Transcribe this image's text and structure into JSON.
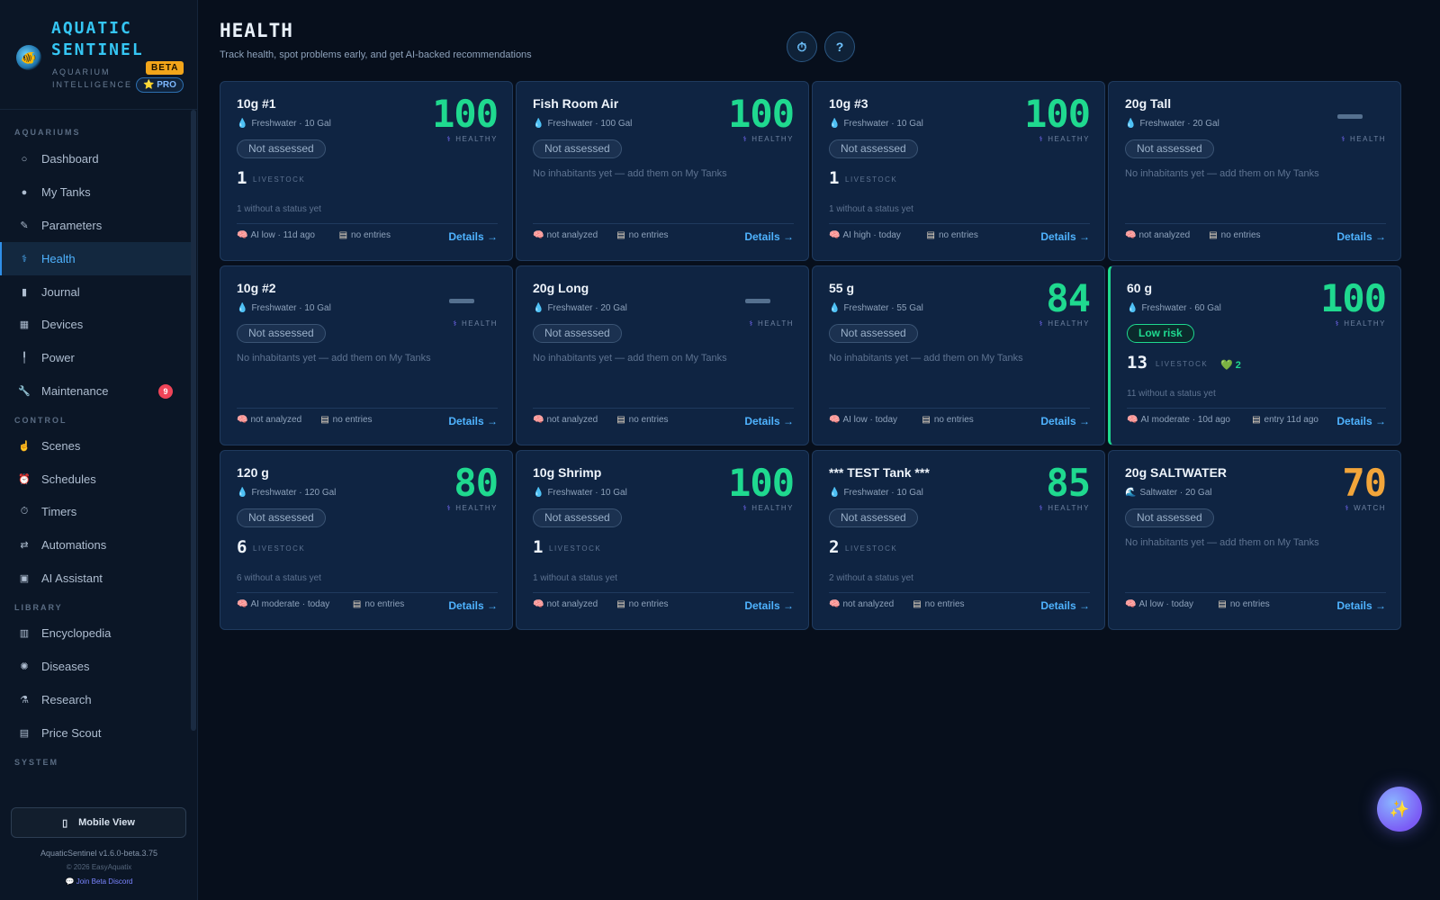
{
  "brand": {
    "name": "AQUATIC SENTINEL",
    "subtitle": "AQUARIUM INTELLIGENCE",
    "beta": "BETA",
    "pro": "⭐ PRO"
  },
  "sidebar": {
    "sections": [
      "AQUARIUMS",
      "CONTROL",
      "LIBRARY",
      "SYSTEM"
    ],
    "items": [
      {
        "label": "Dashboard",
        "icon": "○"
      },
      {
        "label": "My Tanks",
        "icon": "●"
      },
      {
        "label": "Parameters",
        "icon": "✎"
      },
      {
        "label": "Health",
        "icon": "⚕"
      },
      {
        "label": "Journal",
        "icon": "▮"
      },
      {
        "label": "Devices",
        "icon": "▦"
      },
      {
        "label": "Power",
        "icon": "╿"
      },
      {
        "label": "Maintenance",
        "icon": "🔧",
        "count": "9"
      },
      {
        "label": "Scenes",
        "icon": "☝"
      },
      {
        "label": "Schedules",
        "icon": "⏰"
      },
      {
        "label": "Timers",
        "icon": "⏱"
      },
      {
        "label": "Automations",
        "icon": "⇄"
      },
      {
        "label": "AI Assistant",
        "icon": "▣"
      },
      {
        "label": "Encyclopedia",
        "icon": "▥"
      },
      {
        "label": "Diseases",
        "icon": "✺"
      },
      {
        "label": "Research",
        "icon": "⚗"
      },
      {
        "label": "Price Scout",
        "icon": "▤"
      }
    ],
    "mobile_view": "Mobile View",
    "version": "AquaticSentinel v1.6.0-beta.3.75",
    "copyright": "© 2026 EasyAquatix",
    "discord": "💬 Join Beta Discord"
  },
  "header": {
    "title": "HEALTH",
    "subtitle": "Track health, spot problems early, and get AI-backed recommendations",
    "timer_icon": "⏱",
    "help_label": "?"
  },
  "cards": [
    {
      "name": "10g #1",
      "type": "Freshwater · 10 Gal",
      "score": "100",
      "label": "HEALTHY",
      "pill": "Not assessed",
      "livestock": "1",
      "livestock_label": "LIVESTOCK",
      "note": "1 without a status yet",
      "ai": "AI low · 11d ago",
      "journal": "no entries",
      "details": "Details →"
    },
    {
      "name": "Fish Room Air",
      "type": "Freshwater · 100 Gal",
      "score": "100",
      "label": "HEALTHY",
      "pill": "Not assessed",
      "empty": "No inhabitants yet — add them on My Tanks",
      "ai": "not analyzed",
      "journal": "no entries",
      "details": "Details →"
    },
    {
      "name": "10g #3",
      "type": "Freshwater · 10 Gal",
      "score": "100",
      "label": "HEALTHY",
      "pill": "Not assessed",
      "livestock": "1",
      "livestock_label": "LIVESTOCK",
      "note": "1 without a status yet",
      "ai": "AI high · today",
      "journal": "no entries",
      "details": "Details →"
    },
    {
      "name": "20g Tall",
      "type": "Freshwater · 20 Gal",
      "label": "HEALTH",
      "pill": "Not assessed",
      "empty": "No inhabitants yet — add them on My Tanks",
      "ai": "not analyzed",
      "journal": "no entries",
      "details": "Details →"
    },
    {
      "name": "10g #2",
      "type": "Freshwater · 10 Gal",
      "label": "HEALTH",
      "pill": "Not assessed",
      "empty": "No inhabitants yet — add them on My Tanks",
      "ai": "not analyzed",
      "journal": "no entries",
      "details": "Details →"
    },
    {
      "name": "20g Long",
      "type": "Freshwater · 20 Gal",
      "label": "HEALTH",
      "pill": "Not assessed",
      "empty": "No inhabitants yet — add them on My Tanks",
      "ai": "not analyzed",
      "journal": "no entries",
      "details": "Details →"
    },
    {
      "name": "55 g",
      "type": "Freshwater · 55 Gal",
      "score": "84",
      "label": "HEALTHY",
      "pill": "Not assessed",
      "empty": "No inhabitants yet — add them on My Tanks",
      "ai": "AI low · today",
      "journal": "no entries",
      "details": "Details →"
    },
    {
      "name": "60 g",
      "type": "Freshwater · 60 Gal",
      "score": "100",
      "label": "HEALTHY",
      "pill": "Low risk",
      "pill_style": "green",
      "accent": true,
      "livestock": "13",
      "livestock_label": "LIVESTOCK",
      "hearts": "💚 2",
      "note": "11 without a status yet",
      "ai": "AI moderate · 10d ago",
      "journal": "entry 11d ago",
      "details": "Details →"
    },
    {
      "name": "120 g",
      "type": "Freshwater · 120 Gal",
      "score": "80",
      "label": "HEALTHY",
      "pill": "Not assessed",
      "livestock": "6",
      "livestock_label": "LIVESTOCK",
      "note": "6 without a status yet",
      "ai": "AI moderate · today",
      "journal": "no entries",
      "details": "Details →"
    },
    {
      "name": "10g Shrimp",
      "type": "Freshwater · 10 Gal",
      "score": "100",
      "label": "HEALTHY",
      "pill": "Not assessed",
      "livestock": "1",
      "livestock_label": "LIVESTOCK",
      "note": "1 without a status yet",
      "ai": "not analyzed",
      "journal": "no entries",
      "details": "Details →"
    },
    {
      "name": "*** TEST Tank ***",
      "type": "Freshwater · 10 Gal",
      "score": "85",
      "label": "HEALTHY",
      "pill": "Not assessed",
      "livestock": "2",
      "livestock_label": "LIVESTOCK",
      "note": "2 without a status yet",
      "ai": "not analyzed",
      "journal": "no entries",
      "details": "Details →"
    },
    {
      "name": "20g SALTWATER",
      "type": "Saltwater · 20 Gal",
      "type_icon": "wave",
      "score": "70",
      "score_style": "orange",
      "label": "WATCH",
      "pill": "Not assessed",
      "empty": "No inhabitants yet — add them on My Tanks",
      "ai": "AI low · today",
      "journal": "no entries",
      "details": "Details →"
    }
  ],
  "colors": {
    "healthy": "#1fd98f",
    "watch": "#f2a53a",
    "accent": "#4fb3ff",
    "background": "#070f1c"
  },
  "fab_icon": "✨"
}
